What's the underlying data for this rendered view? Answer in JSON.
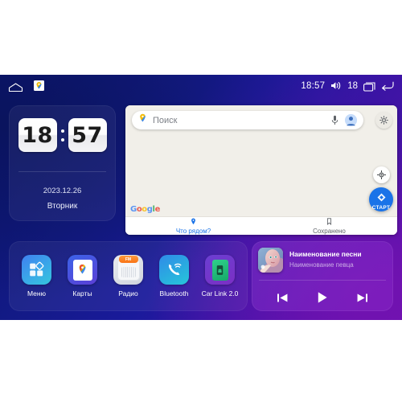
{
  "statusbar": {
    "home_icon": "home-icon",
    "notification_icon": "google-maps-notification-icon",
    "time": "18:57",
    "volume_icon": "volume-icon",
    "volume_level": "18",
    "recents_icon": "recents-icon",
    "back_icon": "back-icon"
  },
  "clock_widget": {
    "hours": "18",
    "minutes": "57",
    "date": "2023.12.26",
    "weekday": "Вторник"
  },
  "maps_widget": {
    "search": {
      "placeholder": "Поиск",
      "pin_icon": "maps-pin-icon",
      "mic_icon": "microphone-icon",
      "avatar_icon": "account-avatar-icon"
    },
    "settings_icon": "settings-gear-icon",
    "locate_icon": "locate-me-icon",
    "start_button": {
      "label": "СТАРТ",
      "icon": "navigation-arrow-icon"
    },
    "brand": {
      "g1": "G",
      "o1": "o",
      "o2": "o",
      "g2": "g",
      "l": "l",
      "e": "e"
    },
    "tabs": [
      {
        "label": "Что рядом?",
        "icon": "pin-icon",
        "active": true
      },
      {
        "label": "Сохранено",
        "icon": "bookmark-icon",
        "active": false
      }
    ]
  },
  "apps": [
    {
      "label": "Меню",
      "icon": "menu-grid-icon"
    },
    {
      "label": "Карты",
      "icon": "maps-icon"
    },
    {
      "label": "Радио",
      "icon": "radio-icon",
      "display": "FM"
    },
    {
      "label": "Bluetooth",
      "icon": "bluetooth-phone-icon"
    },
    {
      "label": "Car Link 2.0",
      "icon": "car-link-icon"
    }
  ],
  "music_widget": {
    "album_art": "album-art-portrait",
    "title": "Наименование песни",
    "artist": "Наименование певца",
    "controls": [
      {
        "name": "previous",
        "icon": "skip-previous-icon"
      },
      {
        "name": "play",
        "icon": "play-icon"
      },
      {
        "name": "next",
        "icon": "skip-next-icon"
      }
    ]
  },
  "colors": {
    "accent_blue": "#1a73e8",
    "bg_start": "#0b1474",
    "bg_end": "#6a12b4",
    "map_bg": "#f1efe9",
    "radio_orange": "#f97316"
  }
}
